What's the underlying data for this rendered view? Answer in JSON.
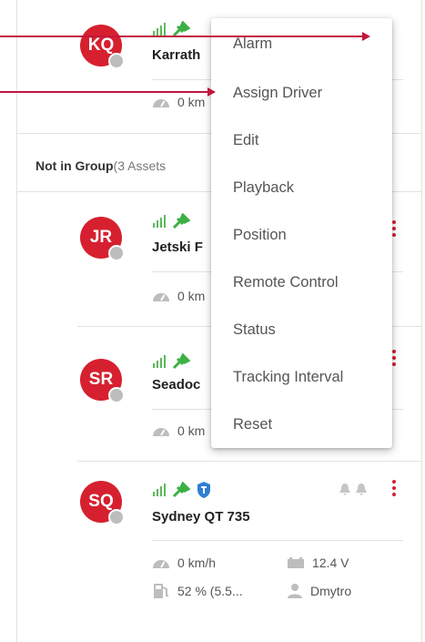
{
  "groups": [
    {
      "assets": [
        {
          "initials": "KQ",
          "name": "Karrath",
          "speed": "0 km"
        }
      ]
    },
    {
      "name": "Not in Group",
      "count_label": "(3 Assets",
      "assets": [
        {
          "initials": "JR",
          "name": "Jetski F",
          "speed": "0 km"
        },
        {
          "initials": "SR",
          "name": "Seadoc",
          "speed": "0 km"
        },
        {
          "initials": "SQ",
          "name": "Sydney QT 735",
          "speed": "0 km/h",
          "voltage": "12.4 V",
          "fuel": "52 % (5.5...",
          "driver": "Dmytro"
        }
      ]
    }
  ],
  "context_menu": {
    "items": [
      "Alarm",
      "Assign Driver",
      "Edit",
      "Playback",
      "Position",
      "Remote Control",
      "Status",
      "Tracking Interval",
      "Reset"
    ]
  },
  "colors": {
    "avatar": "#d6202f",
    "signal": "#5cb85c",
    "gps": "#3cb043",
    "shield": "#2f7fd1",
    "kebab": "#d6202f",
    "annotation_arrow": "#c2163f"
  },
  "icons": [
    "signal-icon",
    "gps-satellite-icon",
    "shield-icon",
    "speedometer-icon",
    "battery-icon",
    "fuel-icon",
    "driver-icon",
    "bell-icon",
    "kebab-menu-icon"
  ]
}
